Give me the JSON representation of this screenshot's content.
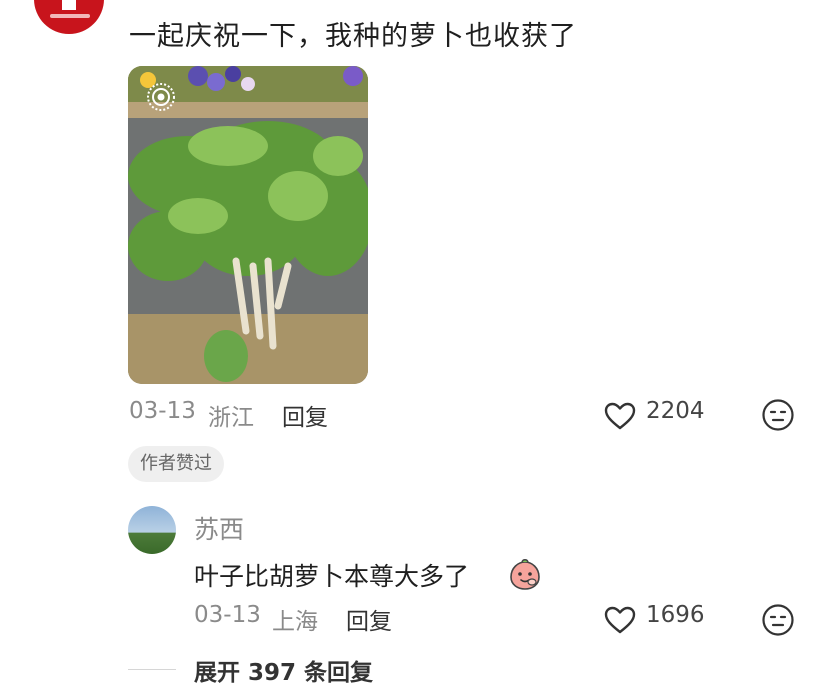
{
  "comment": {
    "text": "一起庆祝一下，我种的萝卜也收获了",
    "date": "03-13",
    "location": "浙江",
    "reply_label": "回复",
    "like_count": "2204",
    "author_badge": "作者赞过",
    "image": {
      "description_icon": "live-photo-icon"
    }
  },
  "sub_reply": {
    "username": "苏西",
    "text": "叶子比胡萝卜本尊大多了",
    "emoji": "peach-emoji",
    "date": "03-13",
    "location": "上海",
    "reply_label": "回复",
    "like_count": "1696"
  },
  "expand": {
    "label": "展开 397 条回复"
  },
  "icons": {
    "heart": "heart-icon",
    "reaction": "emoji-icon"
  },
  "colors": {
    "avatar_red": "#c8141c",
    "text_gray": "#8a8a8a",
    "badge_bg": "#efefef"
  }
}
